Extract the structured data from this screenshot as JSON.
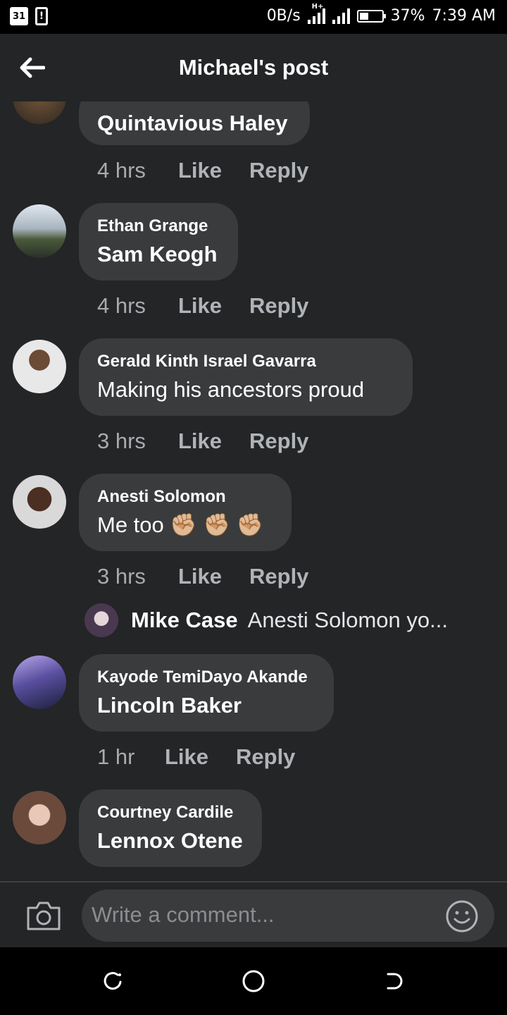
{
  "status_bar": {
    "calendar": "31",
    "notice": "!",
    "net_speed": "0B/s",
    "network_tag": "H+",
    "battery": "37%",
    "time": "7:39 AM"
  },
  "header": {
    "title": "Michael's post"
  },
  "comments": [
    {
      "name": "",
      "text": "Quintavious Haley",
      "time": "4 hrs",
      "like": "Like",
      "reply": "Reply"
    },
    {
      "name": "Ethan Grange",
      "text": "Sam Keogh",
      "time": "4 hrs",
      "like": "Like",
      "reply": "Reply"
    },
    {
      "name": "Gerald Kinth Israel Gavarra",
      "text": "Making his ancestors proud",
      "time": "3 hrs",
      "like": "Like",
      "reply": "Reply"
    },
    {
      "name": "Anesti Solomon",
      "text": "Me too ✊🏼 ✊🏼 ✊🏼",
      "time": "3 hrs",
      "like": "Like",
      "reply": "Reply"
    },
    {
      "name": "Kayode TemiDayo Akande",
      "text": "Lincoln Baker",
      "time": "1 hr",
      "like": "Like",
      "reply": "Reply"
    },
    {
      "name": "Courtney Cardile",
      "text": "Lennox Otene"
    }
  ],
  "reply_preview": {
    "name": "Mike Case",
    "text": "Anesti Solomon yo..."
  },
  "composer": {
    "placeholder": "Write a comment..."
  },
  "icons": {
    "back": "arrow-left-icon",
    "camera": "camera-icon",
    "emoji": "smiley-icon",
    "nav_recent": "recent-apps-icon",
    "nav_home": "home-circle-icon",
    "nav_back": "nav-back-icon"
  },
  "colors": {
    "background": "#242526",
    "bubble": "#3a3b3c",
    "meta": "#b0b3b8"
  }
}
